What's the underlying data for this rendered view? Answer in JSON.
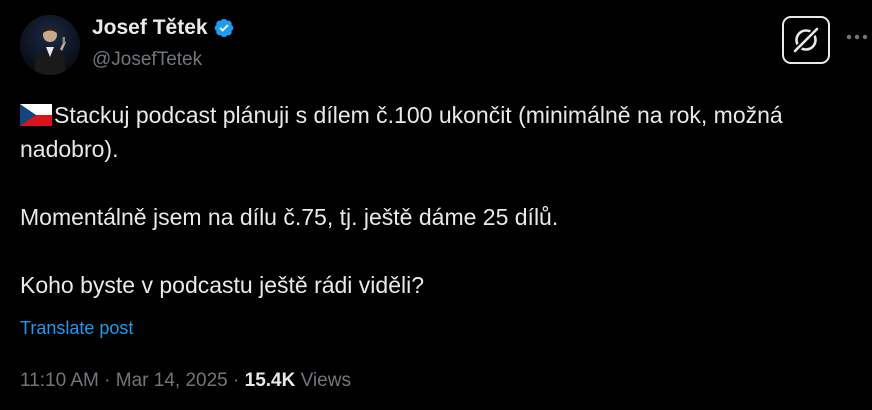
{
  "author": {
    "name": "Josef Tětek",
    "handle": "@JosefTetek",
    "verified": true
  },
  "icons": {
    "avatar": "avatar-photo",
    "verified": "verified-badge-icon",
    "grok": "grok-icon",
    "more": "more-options-icon",
    "flag": "czech-flag-icon"
  },
  "tweet": {
    "paragraphs": [
      "Stackuj podcast plánuji s dílem č.100 ukončit (minimálně na rok, možná nadobro).",
      "Momentálně jsem na dílu č.75, tj. ještě dáme 25 dílů.",
      "Koho byste v podcastu ještě rádi viděli?"
    ]
  },
  "translate": {
    "label": "Translate post"
  },
  "meta": {
    "time": "11:10 AM",
    "separator": " · ",
    "date": "Mar 14, 2025",
    "views_count": "15.4K",
    "views_label": " Views"
  },
  "colors": {
    "background": "#000000",
    "text": "#e7e9ea",
    "muted": "#71767b",
    "link": "#1d9bf0",
    "verified": "#1d9bf0"
  }
}
